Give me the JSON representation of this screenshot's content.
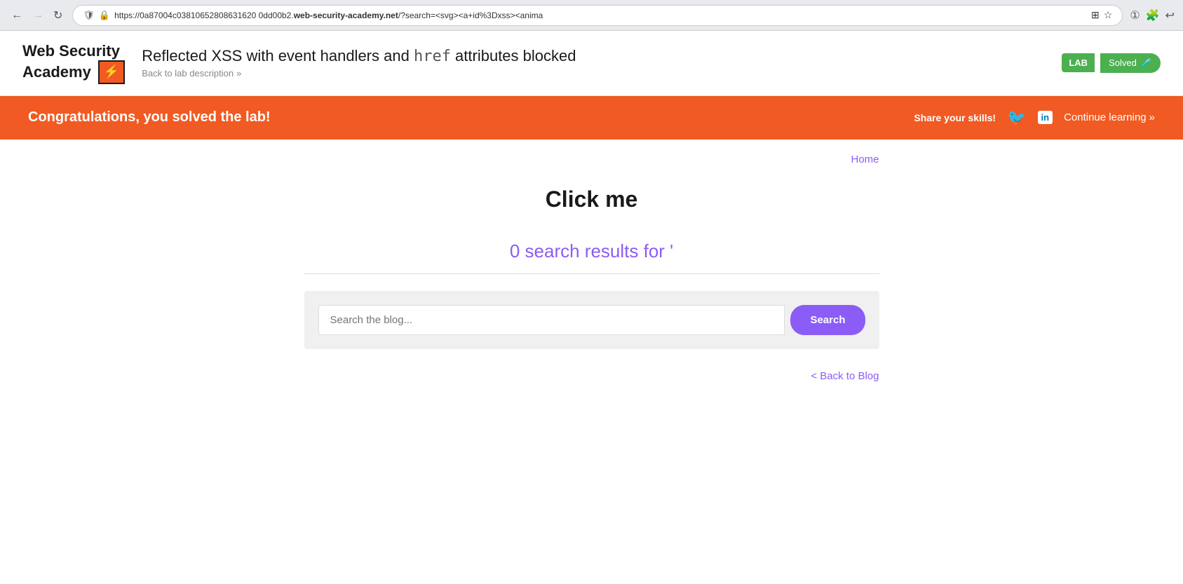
{
  "browser": {
    "url_prefix": "https://0a87004c03810652808631620 0dd00b2.",
    "url_domain": "web-security-academy.net",
    "url_suffix": "/?search=<svg><a+id%3Dxss><anima",
    "back_disabled": false,
    "forward_disabled": false
  },
  "header": {
    "logo_line1": "Web Security",
    "logo_line2": "Academy",
    "logo_icon": "⚡",
    "title_prefix": "Reflected XSS with event handlers and ",
    "title_code": "href",
    "title_suffix": " attributes blocked",
    "back_to_lab": "Back to lab description",
    "lab_badge": "LAB",
    "solved_label": "Solved"
  },
  "banner": {
    "congrats_text": "Congratulations, you solved the lab!",
    "share_label": "Share your skills!",
    "twitter_icon": "🐦",
    "linkedin_icon": "in",
    "continue_learning": "Continue learning",
    "chevron": "»"
  },
  "main": {
    "home_link": "Home",
    "click_me": "Click me",
    "search_results_text": "0 search results for '",
    "search_placeholder": "Search the blog...",
    "search_button": "Search",
    "back_to_blog": "< Back to Blog"
  }
}
